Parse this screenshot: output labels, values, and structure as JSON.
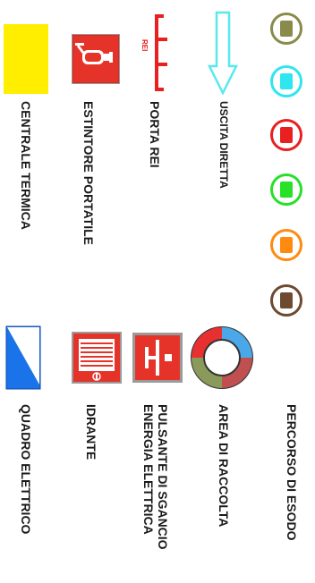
{
  "labels": {
    "centrale_termica": "CENTRALE TERMICA",
    "estintore_portatile": "ESTINTORE PORTATILE",
    "porta_rei": "PORTA REI",
    "porta_rei_mark": "REI",
    "uscita_diretta": "USCITA DIRETTA",
    "quadro_elettrico": "QUADRO ELETTRICO",
    "idrante": "IDRANTE",
    "pulsante_line1": "PULSANTE DI SGANCIO",
    "pulsante_line2": "ENERGIA ELETTRICA",
    "area_di_raccolta": "AREA DI RACCOLTA",
    "percorso_di_esodo": "PERCORSO DI ESODO"
  },
  "route_colors": [
    {
      "name": "olive",
      "ring": "#8a8a4a",
      "fill": "#8a8a4a"
    },
    {
      "name": "cyan",
      "ring": "#2ee6f0",
      "fill": "#2ee6f0"
    },
    {
      "name": "red",
      "ring": "#e82020",
      "fill": "#e82020"
    },
    {
      "name": "green",
      "ring": "#28e028",
      "fill": "#28e028"
    },
    {
      "name": "orange",
      "ring": "#ff8a10",
      "fill": "#ff8a10"
    },
    {
      "name": "brown",
      "ring": "#6e4a30",
      "fill": "#6e4a30"
    }
  ],
  "colors": {
    "centrale": "#ffee00",
    "sign_red": "#e5332a",
    "arrow": "#58e8f0",
    "quadro_blue": "#1a73e8"
  },
  "icons": {
    "estintore": "fire-extinguisher-icon",
    "porta_rei": "fire-door-icon",
    "uscita": "exit-arrow-icon",
    "quadro": "electrical-panel-icon",
    "idrante": "fire-hydrant-icon",
    "pulsante": "power-cutoff-button-icon",
    "area": "assembly-area-icon"
  }
}
